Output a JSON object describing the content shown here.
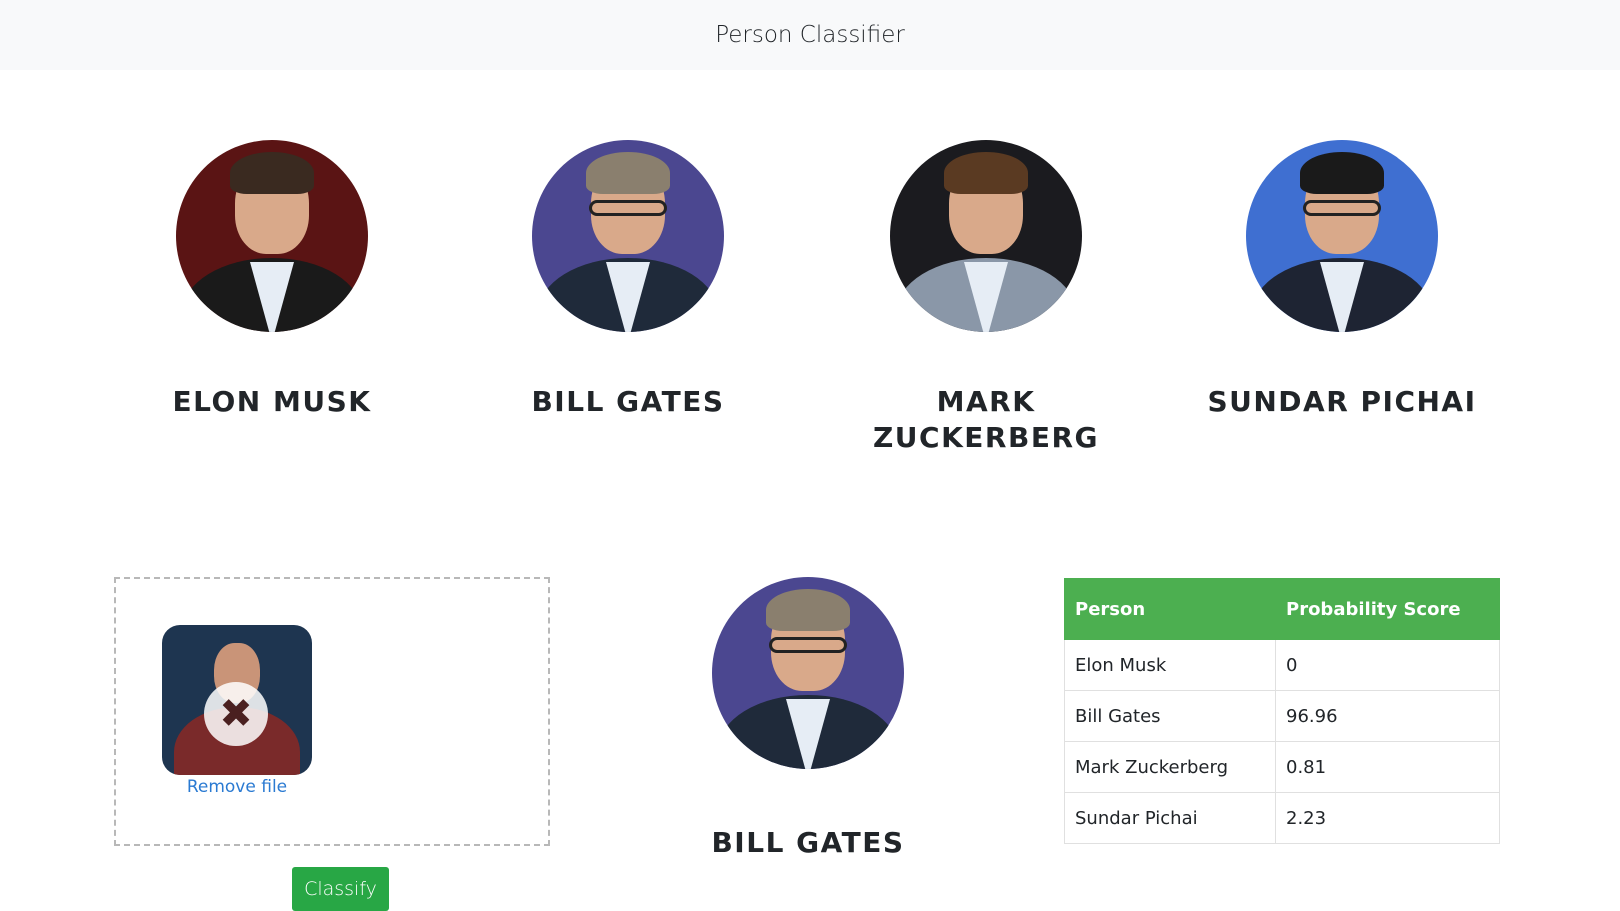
{
  "header": {
    "title": "Person Classifier"
  },
  "people": [
    {
      "name": "Elon Musk",
      "bg": "#5a1414",
      "hair": "#3a2a20",
      "suit": "#1a1a1a"
    },
    {
      "name": "Bill Gates",
      "bg": "#4b4790",
      "hair": "#8a7f6e",
      "suit": "#1f2a3a"
    },
    {
      "name": "Mark Zuckerberg",
      "bg": "#1b1b1f",
      "hair": "#5a3a22",
      "suit": "#8a97a8"
    },
    {
      "name": "Sundar Pichai",
      "bg": "#3f6fd1",
      "hair": "#1a1a1a",
      "suit": "#1e2433"
    }
  ],
  "upload": {
    "remove_label": "Remove file",
    "classify_label": "Classify"
  },
  "result": {
    "name": "Bill Gates"
  },
  "table": {
    "headers": [
      "Person",
      "Probability Score"
    ],
    "rows": [
      [
        "Elon Musk",
        "0"
      ],
      [
        "Bill Gates",
        "96.96"
      ],
      [
        "Mark Zuckerberg",
        "0.81"
      ],
      [
        "Sundar Pichai",
        "2.23"
      ]
    ]
  }
}
